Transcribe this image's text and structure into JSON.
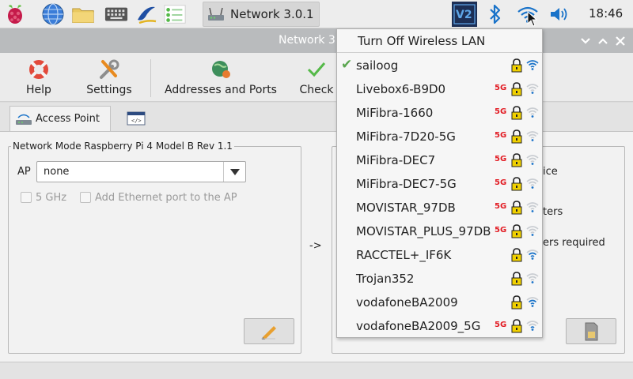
{
  "taskbar": {
    "task_label": "Network 3.0.1",
    "clock": "18:46"
  },
  "window": {
    "title": "Network 3"
  },
  "toolbar": {
    "help": "Help",
    "settings": "Settings",
    "addresses": "Addresses and Ports",
    "check": "Check"
  },
  "tabs": {
    "access_point": "Access Point"
  },
  "panel": {
    "group_title": "Network Mode  Raspberry Pi 4 Model B Rev 1.1",
    "ap_label": "AP",
    "ap_value": "none",
    "check_5ghz": "5 GHz",
    "check_ethernet": "Add Ethernet port to the AP",
    "arrow": "->",
    "right_partial_1": "ice",
    "right_partial_2": "ters",
    "right_partial_3": "ers required"
  },
  "wifi_menu": {
    "header": "Turn Off Wireless LAN",
    "networks": [
      {
        "name": "sailoog",
        "connected": true,
        "band5g": false,
        "signal": 0.95
      },
      {
        "name": "Livebox6-B9D0",
        "connected": false,
        "band5g": true,
        "signal": 0.2
      },
      {
        "name": "MiFibra-1660",
        "connected": false,
        "band5g": true,
        "signal": 0.2
      },
      {
        "name": "MiFibra-7D20-5G",
        "connected": false,
        "band5g": true,
        "signal": 0.2
      },
      {
        "name": "MiFibra-DEC7",
        "connected": false,
        "band5g": true,
        "signal": 0.2
      },
      {
        "name": "MiFibra-DEC7-5G",
        "connected": false,
        "band5g": true,
        "signal": 0.2
      },
      {
        "name": "MOVISTAR_97DB",
        "connected": false,
        "band5g": true,
        "signal": 0.2
      },
      {
        "name": "MOVISTAR_PLUS_97DB",
        "connected": false,
        "band5g": true,
        "signal": 0.2
      },
      {
        "name": "RACCTEL+_IF6K",
        "connected": false,
        "band5g": false,
        "signal": 0.6
      },
      {
        "name": "Trojan352",
        "connected": false,
        "band5g": false,
        "signal": 0.2
      },
      {
        "name": "vodafoneBA2009",
        "connected": false,
        "band5g": false,
        "signal": 0.6
      },
      {
        "name": "vodafoneBA2009_5G",
        "connected": false,
        "band5g": true,
        "signal": 0.4
      }
    ],
    "band_label": "5G"
  },
  "colors": {
    "accent_blue": "#1a73c9",
    "check_green": "#5aa64f",
    "band_red": "#e21b23",
    "lock_yellow": "#f0d000"
  },
  "icons": [
    "raspberry-icon",
    "globe-icon",
    "folder-icon",
    "keyboard-icon",
    "blue-logo-icon",
    "checklist-icon",
    "network-icon",
    "vnc-icon",
    "bluetooth-icon",
    "wifi-icon",
    "volume-icon"
  ]
}
